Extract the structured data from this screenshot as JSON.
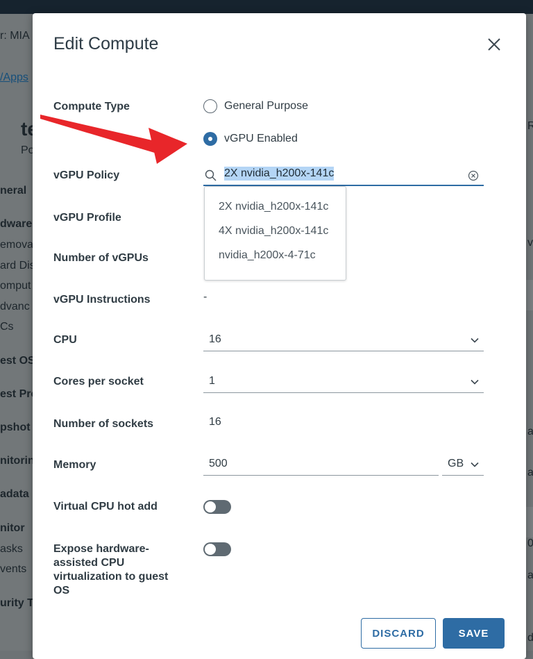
{
  "background": {
    "fragments": [
      "r: MIA",
      "/Apps",
      "te",
      "Po",
      "neral",
      "dware",
      "emova",
      "ard Dis",
      "omput",
      "dvanc",
      "Cs",
      "est OS",
      "est Pro",
      "pshot",
      "nitorin",
      "adata",
      "nitor",
      "asks",
      "vents",
      "urity T",
      "R",
      "v",
      "a",
      "a",
      "0",
      "a",
      "d"
    ]
  },
  "dialog": {
    "title": "Edit Compute",
    "close_icon": "close-icon",
    "fields": {
      "compute_type": {
        "label": "Compute Type",
        "options": [
          "General Purpose",
          "vGPU Enabled"
        ],
        "selected": "vGPU Enabled"
      },
      "vgpu_policy": {
        "label": "vGPU Policy",
        "value": "2X nvidia_h200x-141c",
        "dropdown_options": [
          "2X nvidia_h200x-141c",
          "4X nvidia_h200x-141c",
          "nvidia_h200x-4-71c"
        ]
      },
      "vgpu_profile": {
        "label": "vGPU Profile"
      },
      "number_of_vgpus": {
        "label": "Number of vGPUs"
      },
      "vgpu_instructions": {
        "label": "vGPU Instructions",
        "value": "-"
      },
      "cpu": {
        "label": "CPU",
        "value": "16"
      },
      "cores_per_socket": {
        "label": "Cores per socket",
        "value": "1"
      },
      "number_of_sockets": {
        "label": "Number of sockets",
        "value": "16"
      },
      "memory": {
        "label": "Memory",
        "value": "500",
        "unit": "GB"
      },
      "virtual_cpu_hot_add": {
        "label": "Virtual CPU hot add",
        "enabled": false
      },
      "expose_hw_virt": {
        "label_lines": [
          "Expose hardware-",
          "assisted CPU",
          "virtualization to guest",
          "OS"
        ],
        "enabled": false
      }
    },
    "buttons": {
      "discard": "DISCARD",
      "save": "SAVE"
    }
  },
  "colors": {
    "accent": "#2e6ca4",
    "highlight": "#b4d5f5",
    "annotation_arrow": "#e8262a",
    "overlay": "#727779"
  }
}
